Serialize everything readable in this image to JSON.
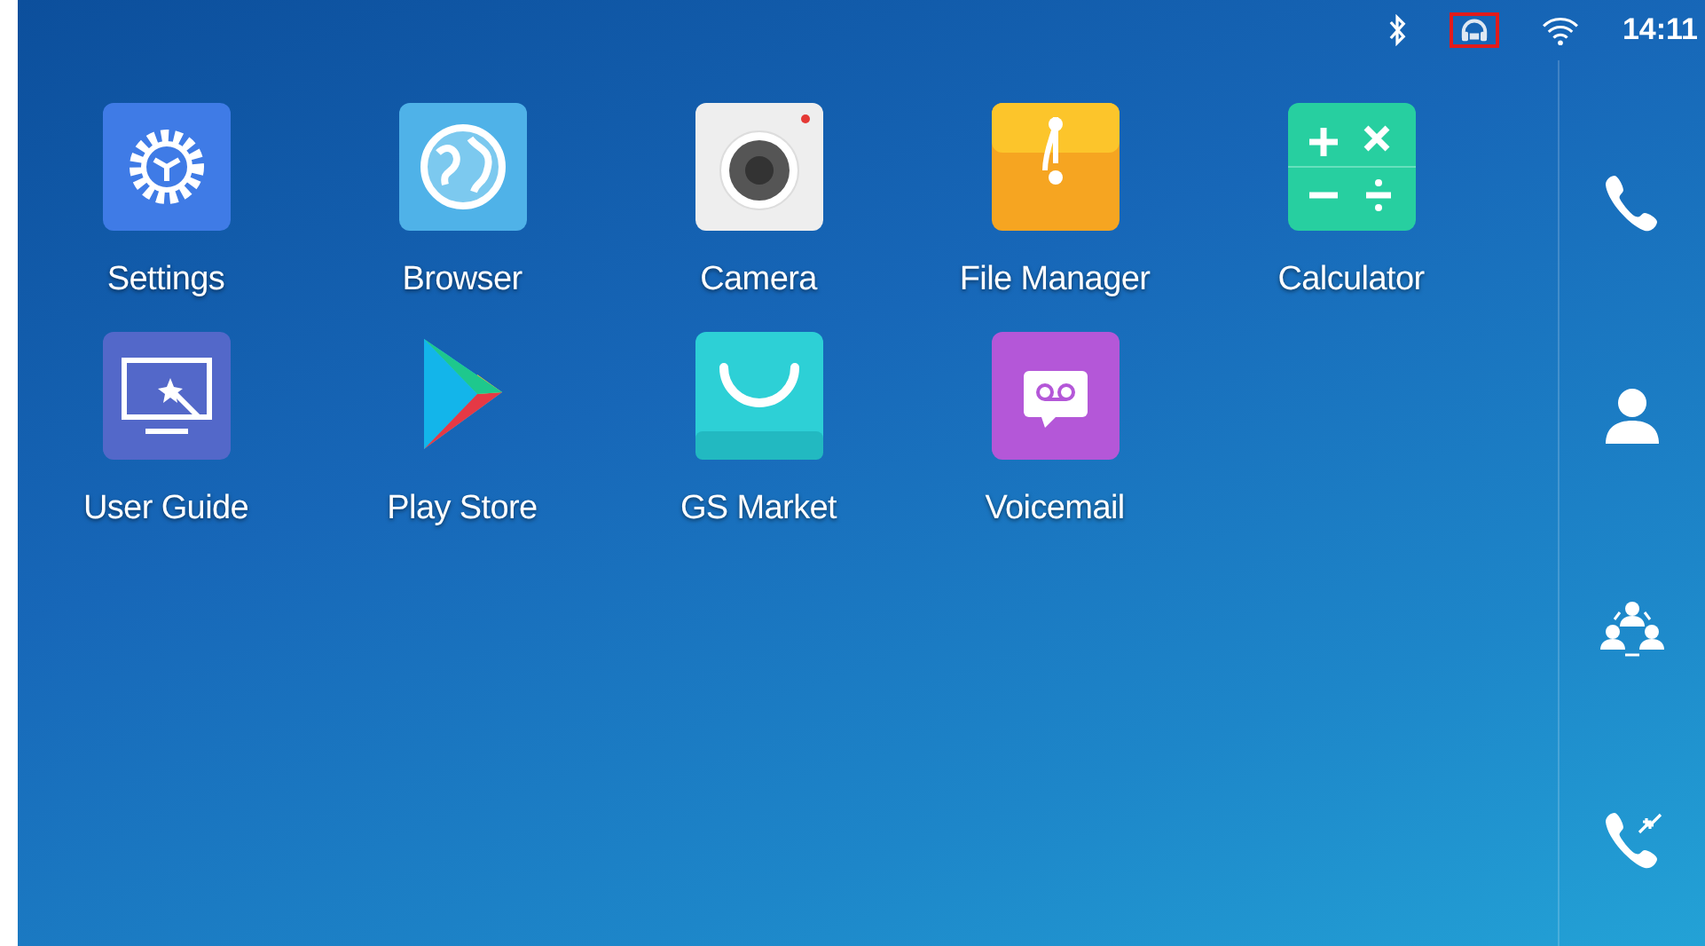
{
  "status_bar": {
    "icons": [
      {
        "kind": "bluetooth",
        "highlighted": false
      },
      {
        "kind": "headset",
        "highlighted": true
      },
      {
        "kind": "wifi",
        "highlighted": false
      }
    ],
    "time": "14:11"
  },
  "apps": [
    {
      "label": "Settings",
      "kind": "settings"
    },
    {
      "label": "Browser",
      "kind": "browser"
    },
    {
      "label": "Camera",
      "kind": "camera"
    },
    {
      "label": "File Manager",
      "kind": "files"
    },
    {
      "label": "Calculator",
      "kind": "calculator"
    },
    {
      "label": "User Guide",
      "kind": "guide"
    },
    {
      "label": "Play Store",
      "kind": "play"
    },
    {
      "label": "GS Market",
      "kind": "market"
    },
    {
      "label": "Voicemail",
      "kind": "voicemail"
    }
  ],
  "sidebar": [
    {
      "kind": "phone"
    },
    {
      "kind": "contact"
    },
    {
      "kind": "conference"
    },
    {
      "kind": "transfer"
    }
  ]
}
